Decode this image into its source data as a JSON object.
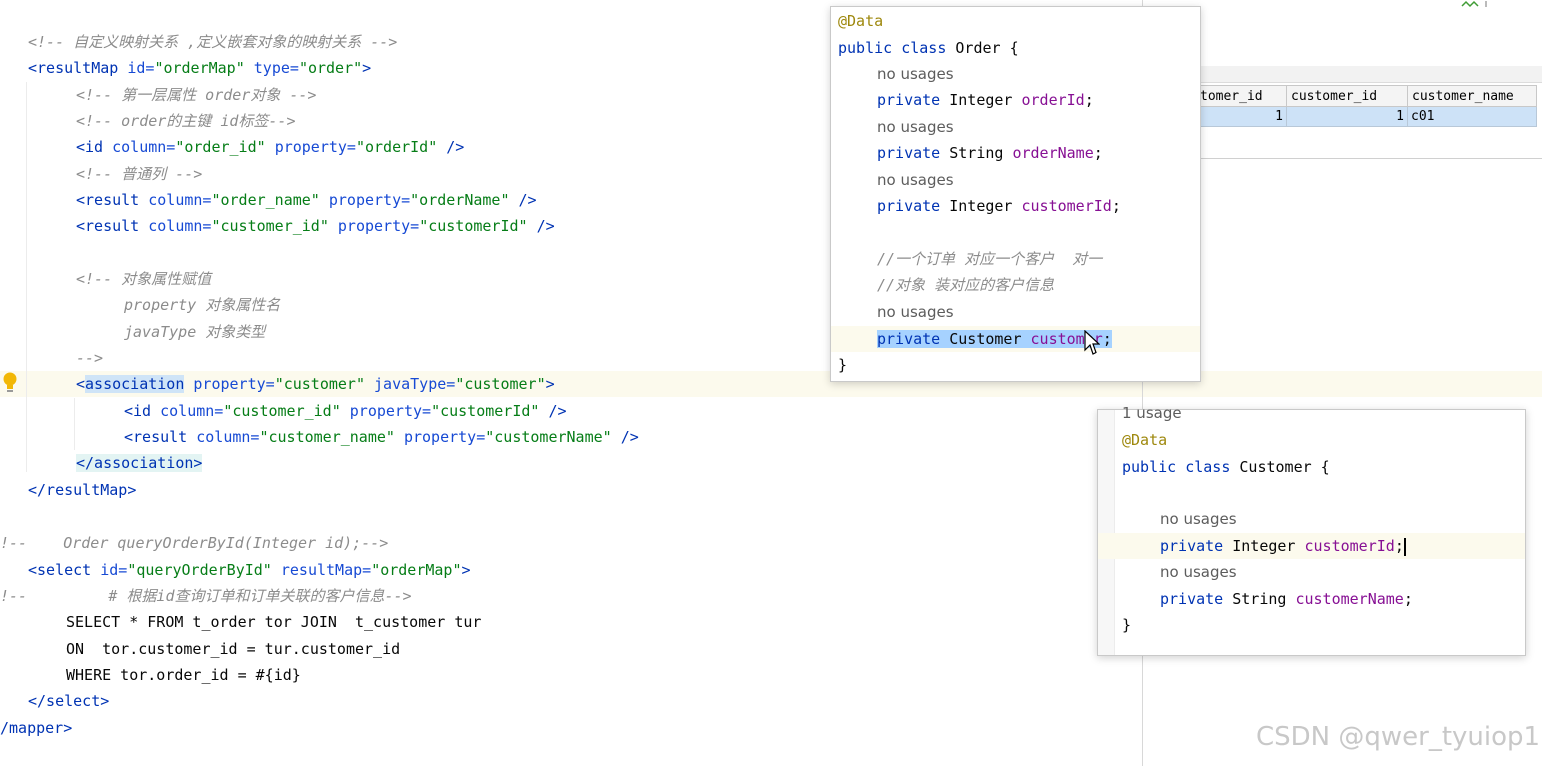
{
  "editor": {
    "lines": [
      {
        "id": "l1",
        "parts": [
          {
            "c": "cmt",
            "t": "<!-- 自定义映射关系 ,定义嵌套对象的映射关系 -->"
          }
        ]
      },
      {
        "id": "l2",
        "parts": [
          {
            "c": "tag",
            "t": "<resultMap "
          },
          {
            "c": "attr",
            "t": "id="
          },
          {
            "c": "str",
            "t": "\"orderMap\" "
          },
          {
            "c": "attr",
            "t": "type="
          },
          {
            "c": "str",
            "t": "\"order\""
          },
          {
            "c": "tag",
            "t": ">"
          }
        ]
      },
      {
        "id": "l3",
        "parts": [
          {
            "c": "cmt",
            "t": "<!-- 第一层属性 order对象 -->"
          }
        ]
      },
      {
        "id": "l4",
        "parts": [
          {
            "c": "cmt",
            "t": "<!-- order的主键 id标签-->"
          }
        ]
      },
      {
        "id": "l5",
        "parts": [
          {
            "c": "tag",
            "t": "<id "
          },
          {
            "c": "attr",
            "t": "column="
          },
          {
            "c": "str",
            "t": "\"order_id\" "
          },
          {
            "c": "attr",
            "t": "property="
          },
          {
            "c": "str",
            "t": "\"orderId\" "
          },
          {
            "c": "tag",
            "t": "/>"
          }
        ]
      },
      {
        "id": "l6",
        "parts": [
          {
            "c": "cmt",
            "t": "<!-- 普通列 -->"
          }
        ]
      },
      {
        "id": "l7",
        "parts": [
          {
            "c": "tag",
            "t": "<result "
          },
          {
            "c": "attr",
            "t": "column="
          },
          {
            "c": "str",
            "t": "\"order_name\" "
          },
          {
            "c": "attr",
            "t": "property="
          },
          {
            "c": "str",
            "t": "\"orderName\" "
          },
          {
            "c": "tag",
            "t": "/>"
          }
        ]
      },
      {
        "id": "l8",
        "parts": [
          {
            "c": "tag",
            "t": "<result "
          },
          {
            "c": "attr",
            "t": "column="
          },
          {
            "c": "str",
            "t": "\"customer_id\" "
          },
          {
            "c": "attr",
            "t": "property="
          },
          {
            "c": "str",
            "t": "\"customerId\" "
          },
          {
            "c": "tag",
            "t": "/>"
          }
        ]
      },
      {
        "id": "l9",
        "parts": [
          {
            "c": "cmt",
            "t": "<!-- 对象属性赋值"
          }
        ]
      },
      {
        "id": "l10",
        "parts": [
          {
            "c": "cmt",
            "t": "property 对象属性名"
          }
        ]
      },
      {
        "id": "l11",
        "parts": [
          {
            "c": "cmt",
            "t": "javaType 对象类型"
          }
        ]
      },
      {
        "id": "l12",
        "parts": [
          {
            "c": "cmt",
            "t": "-->"
          }
        ]
      },
      {
        "id": "l13",
        "parts": [
          {
            "c": "tag",
            "t": "<"
          },
          {
            "c": "tag assoc-sel",
            "t": "association"
          },
          {
            "c": "plain",
            "t": " "
          },
          {
            "c": "attr",
            "t": "property="
          },
          {
            "c": "str",
            "t": "\"customer\" "
          },
          {
            "c": "attr",
            "t": "javaType="
          },
          {
            "c": "str",
            "t": "\"customer\""
          },
          {
            "c": "tag",
            "t": ">"
          }
        ]
      },
      {
        "id": "l14",
        "parts": [
          {
            "c": "tag",
            "t": "<id "
          },
          {
            "c": "attr",
            "t": "column="
          },
          {
            "c": "str",
            "t": "\"customer_id\" "
          },
          {
            "c": "attr",
            "t": "property="
          },
          {
            "c": "str",
            "t": "\"customerId\" "
          },
          {
            "c": "tag",
            "t": "/>"
          }
        ]
      },
      {
        "id": "l15",
        "parts": [
          {
            "c": "tag",
            "t": "<result "
          },
          {
            "c": "attr",
            "t": "column="
          },
          {
            "c": "str",
            "t": "\"customer_name\" "
          },
          {
            "c": "attr",
            "t": "property="
          },
          {
            "c": "str",
            "t": "\"customerName\" "
          },
          {
            "c": "tag",
            "t": "/>"
          }
        ]
      },
      {
        "id": "l16",
        "parts": [
          {
            "c": "tag assoc-end",
            "t": "</association>"
          }
        ]
      },
      {
        "id": "l17",
        "parts": [
          {
            "c": "tag",
            "t": "</resultMap>"
          }
        ]
      },
      {
        "id": "l18",
        "parts": [
          {
            "c": "cmt",
            "t": "!--    Order queryOrderById(Integer id);-->"
          }
        ]
      },
      {
        "id": "l19",
        "parts": [
          {
            "c": "tag",
            "t": "<select "
          },
          {
            "c": "attr",
            "t": "id="
          },
          {
            "c": "str",
            "t": "\"queryOrderById\" "
          },
          {
            "c": "attr",
            "t": "resultMap="
          },
          {
            "c": "str",
            "t": "\"orderMap\""
          },
          {
            "c": "tag",
            "t": ">"
          }
        ]
      },
      {
        "id": "l20",
        "parts": [
          {
            "c": "cmt",
            "t": "!--         # 根据id查询订单和订单关联的客户信息-->"
          }
        ]
      },
      {
        "id": "l21",
        "parts": [
          {
            "c": "plain",
            "t": "SELECT * FROM t_order tor JOIN  t_customer tur"
          }
        ]
      },
      {
        "id": "l22",
        "parts": [
          {
            "c": "plain",
            "t": "ON  tor.customer_id = tur.customer_id"
          }
        ]
      },
      {
        "id": "l23",
        "parts": [
          {
            "c": "plain",
            "t": "WHERE tor.order_id = #{id}"
          }
        ]
      },
      {
        "id": "l24",
        "parts": [
          {
            "c": "tag",
            "t": "</select>"
          }
        ]
      },
      {
        "id": "l25",
        "parts": [
          {
            "c": "tag",
            "t": "/mapper>"
          }
        ]
      }
    ]
  },
  "db_table": {
    "headers": [
      "tomer_id",
      "customer_id",
      "customer_name"
    ],
    "rows": [
      [
        "1",
        "1",
        "c01"
      ]
    ]
  },
  "order_popup": {
    "lines": [
      {
        "parts": [
          {
            "c": "ann",
            "t": "@Data"
          }
        ]
      },
      {
        "parts": [
          {
            "c": "kw",
            "t": "public class "
          },
          {
            "c": "plain",
            "t": "Order {"
          }
        ]
      },
      {
        "parts": [
          {
            "c": "usage",
            "t": "no usages"
          }
        ]
      },
      {
        "parts": [
          {
            "c": "kw",
            "t": "private "
          },
          {
            "c": "plain",
            "t": "Integer "
          },
          {
            "c": "field",
            "t": "orderId"
          },
          {
            "c": "plain",
            "t": ";"
          }
        ]
      },
      {
        "parts": [
          {
            "c": "usage",
            "t": "no usages"
          }
        ]
      },
      {
        "parts": [
          {
            "c": "kw",
            "t": "private "
          },
          {
            "c": "plain",
            "t": "String "
          },
          {
            "c": "field",
            "t": "orderName"
          },
          {
            "c": "plain",
            "t": ";"
          }
        ]
      },
      {
        "parts": [
          {
            "c": "usage",
            "t": "no usages"
          }
        ]
      },
      {
        "parts": [
          {
            "c": "kw",
            "t": "private "
          },
          {
            "c": "plain",
            "t": "Integer "
          },
          {
            "c": "field",
            "t": "customerId"
          },
          {
            "c": "plain",
            "t": ";"
          }
        ]
      },
      {
        "parts": []
      },
      {
        "parts": [
          {
            "c": "cmt",
            "t": "//一个订单 对应一个客户  对一"
          }
        ]
      },
      {
        "parts": [
          {
            "c": "cmt",
            "t": "//对象 装对应的客户信息"
          }
        ]
      },
      {
        "parts": [
          {
            "c": "usage",
            "t": "no usages"
          }
        ]
      },
      {
        "parts": [
          {
            "c": "kw sel",
            "t": "private "
          },
          {
            "c": "plain sel",
            "t": "Customer "
          },
          {
            "c": "field sel",
            "t": "customer"
          },
          {
            "c": "plain sel",
            "t": ";"
          }
        ]
      },
      {
        "parts": [
          {
            "c": "plain",
            "t": "}"
          }
        ]
      }
    ]
  },
  "customer_popup": {
    "lines": [
      {
        "parts": [
          {
            "c": "usage",
            "t": "1 usage"
          }
        ]
      },
      {
        "parts": [
          {
            "c": "ann",
            "t": "@Data"
          }
        ]
      },
      {
        "parts": [
          {
            "c": "kw",
            "t": "public class "
          },
          {
            "c": "plain",
            "t": "Customer {"
          }
        ]
      },
      {
        "parts": []
      },
      {
        "parts": [
          {
            "c": "usage",
            "t": "no usages"
          }
        ]
      },
      {
        "parts": [
          {
            "c": "kw",
            "t": "private "
          },
          {
            "c": "plain",
            "t": "Integer "
          },
          {
            "c": "field",
            "t": "customerId"
          },
          {
            "c": "plain",
            "t": ";"
          }
        ]
      },
      {
        "parts": [
          {
            "c": "usage",
            "t": "no usages"
          }
        ]
      },
      {
        "parts": [
          {
            "c": "kw",
            "t": "private "
          },
          {
            "c": "plain",
            "t": "String "
          },
          {
            "c": "field",
            "t": "customerName"
          },
          {
            "c": "plain",
            "t": ";"
          }
        ]
      },
      {
        "parts": [
          {
            "c": "plain",
            "t": "}"
          }
        ]
      }
    ]
  },
  "watermark": "CSDN @qwer_tyuiop1",
  "colors": {
    "tag": "#0033b3",
    "attribute": "#174ad4",
    "string": "#067d17",
    "comment": "#8c8c8c",
    "field": "#871094",
    "annotation": "#9e880d",
    "selection": "#a6d2ff"
  },
  "icons": [
    "lightbulb-icon",
    "mouse-pointer-icon"
  ]
}
